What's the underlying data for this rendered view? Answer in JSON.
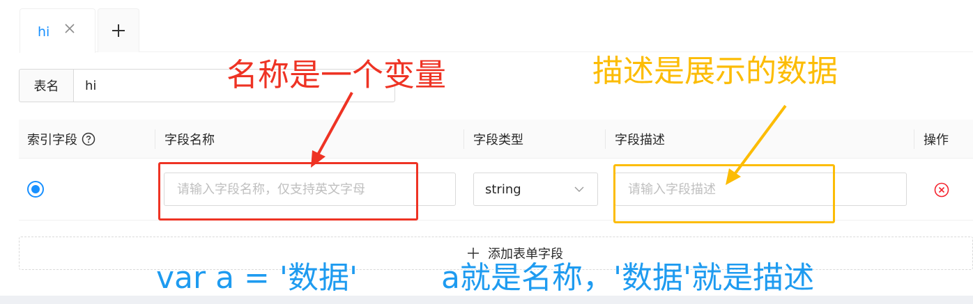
{
  "tabs": {
    "items": [
      {
        "label": "hi",
        "active": true
      }
    ],
    "add_icon": "plus-icon",
    "close_icon": "close-icon"
  },
  "table_name": {
    "label": "表名",
    "value": "hi"
  },
  "table": {
    "columns": {
      "index": "索引字段",
      "name": "字段名称",
      "type": "字段类型",
      "desc": "字段描述",
      "action": "操作"
    },
    "help_icon": "question-circle-icon",
    "rows": [
      {
        "index_selected": true,
        "name_value": "",
        "name_placeholder": "请输入字段名称，仅支持英文字母",
        "type_value": "string",
        "desc_value": "",
        "desc_placeholder": "请输入字段描述",
        "delete_icon": "close-circle-icon"
      }
    ],
    "add_label": "添加表单字段"
  },
  "annotations": {
    "name_note": "名称是一个变量",
    "desc_note": "描述是展示的数据",
    "code_example": "var a = '数据'",
    "explanation": "a就是名称，'数据'就是描述",
    "colors": {
      "red": "#ee3324",
      "yellow": "#fcbc05",
      "blue": "#1e9bf0"
    }
  },
  "theme": {
    "primary": "#1890ff",
    "danger": "#f5222d"
  }
}
